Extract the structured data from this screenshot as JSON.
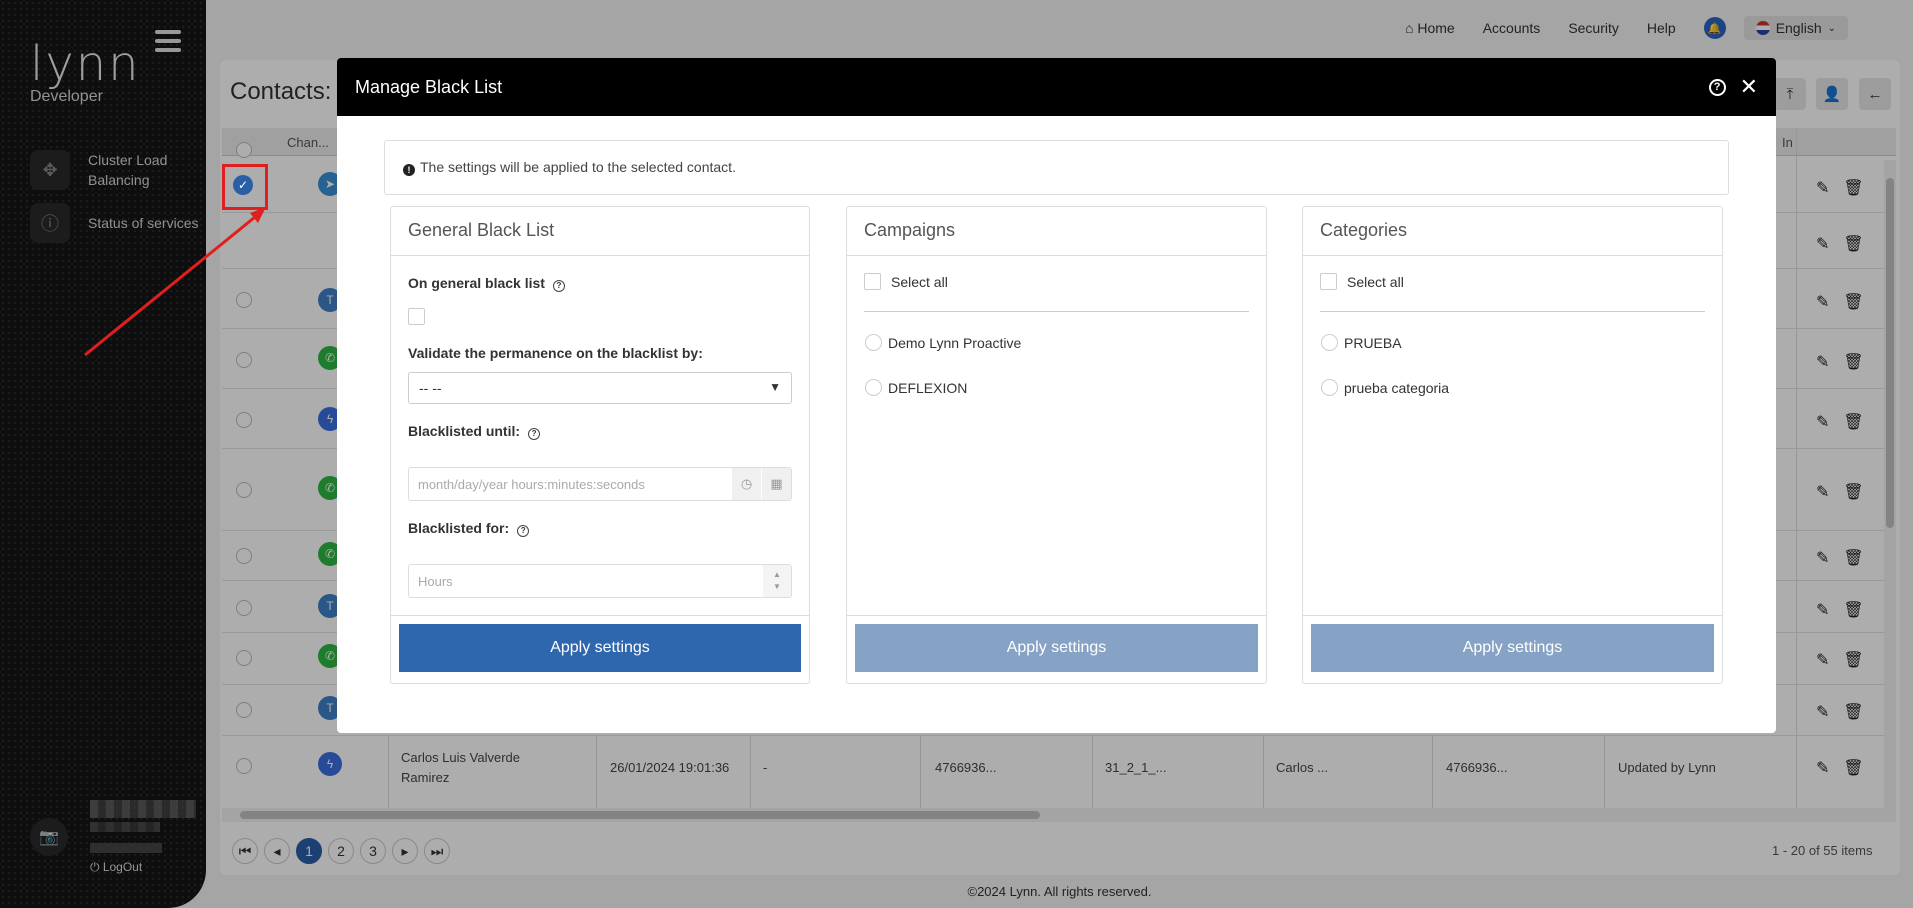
{
  "sidebar": {
    "logo": "lynn",
    "role": "Developer",
    "items": [
      {
        "label": "Cluster Load Balancing"
      },
      {
        "label": "Status of services"
      }
    ],
    "logout": "LogOut"
  },
  "topnav": {
    "home": "Home",
    "accounts": "Accounts",
    "security": "Security",
    "help": "Help",
    "language": "English"
  },
  "page": {
    "title": "Contacts:",
    "columns": {
      "channel": "Chan...",
      "info": "In"
    },
    "last_row": {
      "name": "Carlos Luis Valverde Ramirez",
      "date": "26/01/2024 19:01:36",
      "dash": "-",
      "phone": "4766936...",
      "code": "31_2_1_...",
      "contact": "Carlos ...",
      "phone2": "4766936...",
      "status": "Updated by Lynn"
    },
    "pagination": {
      "pages": [
        "1",
        "2",
        "3"
      ],
      "current": "1"
    },
    "items_text": "1 - 20 of 55 items",
    "footer": "©2024 Lynn. All rights reserved."
  },
  "modal": {
    "title": "Manage Black List",
    "info": "The settings will be applied to the selected contact.",
    "general": {
      "title": "General Black List",
      "on_general_label": "On general black list",
      "validate_label": "Validate the permanence on the blacklist by:",
      "validate_value": "-- --",
      "until_label": "Blacklisted until:",
      "until_placeholder": "month/day/year hours:minutes:seconds",
      "for_label": "Blacklisted for:",
      "for_placeholder": "Hours",
      "apply": "Apply settings"
    },
    "campaigns": {
      "title": "Campaigns",
      "select_all": "Select all",
      "options": [
        "Demo Lynn Proactive",
        "DEFLEXION"
      ],
      "apply": "Apply settings"
    },
    "categories": {
      "title": "Categories",
      "select_all": "Select all",
      "options": [
        "PRUEBA",
        "prueba categoria"
      ],
      "apply": "Apply settings"
    }
  },
  "colors": {
    "primary": "#2e67ad",
    "disabled": "#86a3c5",
    "annotation": "#e01f1f",
    "header": "#000000"
  }
}
